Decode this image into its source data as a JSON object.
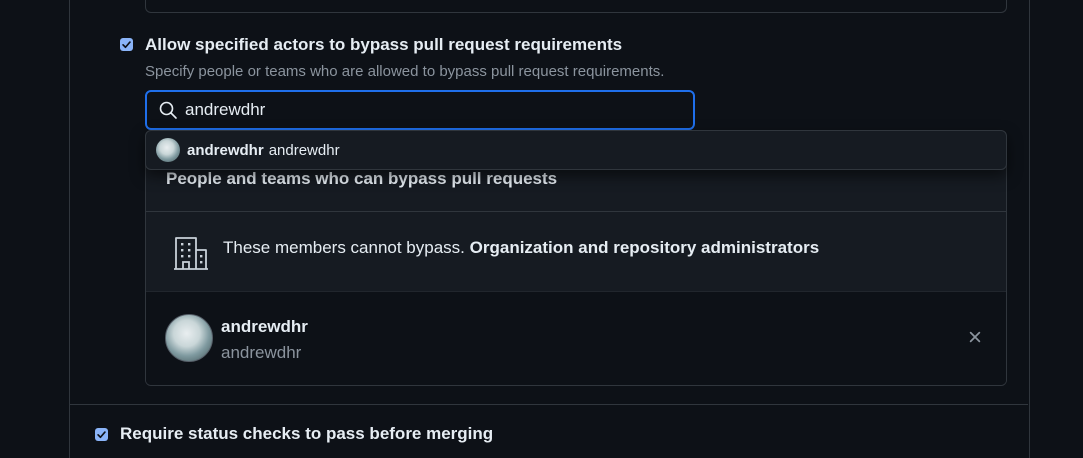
{
  "bypass_option": {
    "checked": true,
    "label": "Allow specified actors to bypass pull request requirements",
    "description": "Specify people or teams who are allowed to bypass pull request requirements."
  },
  "search": {
    "value": "andrewdhr",
    "icon": "search-icon"
  },
  "suggestion": {
    "name": "andrewdhr",
    "login": "andrewdhr"
  },
  "bypass_list": {
    "header": "People and teams who can bypass pull requests",
    "admin_note": "These members cannot bypass.",
    "admin_group": "Organization and repository administrators",
    "users": [
      {
        "name": "andrewdhr",
        "login": "andrewdhr"
      }
    ]
  },
  "next_option": {
    "checked": true,
    "label": "Require status checks to pass before merging"
  },
  "colors": {
    "accent": "#1f6feb",
    "checkbox": "#8ab4f8",
    "background": "#0d1117",
    "surface": "#161b22",
    "border": "#30363d",
    "muted_text": "#8b949e"
  }
}
